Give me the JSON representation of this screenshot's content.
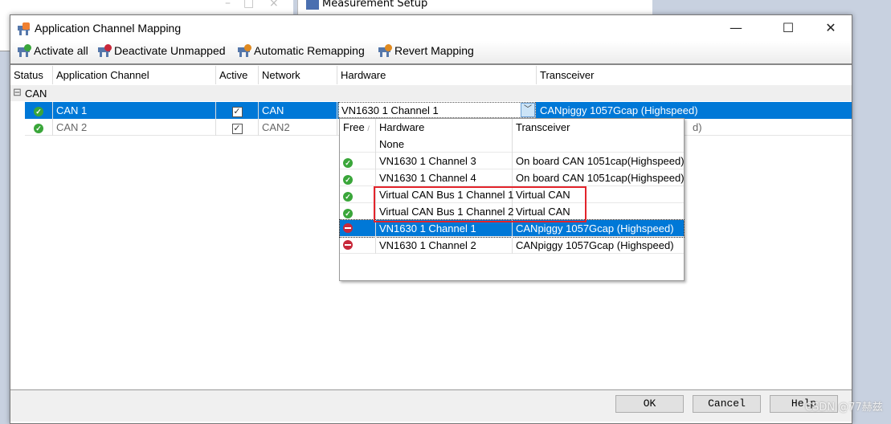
{
  "background": {
    "window_title": "Measurement Setup"
  },
  "dialog": {
    "title": "Application Channel Mapping",
    "toolbar": {
      "activate_all": "Activate all",
      "deactivate_unmapped": "Deactivate Unmapped",
      "automatic_remapping": "Automatic Remapping",
      "revert_mapping": "Revert Mapping"
    },
    "columns": [
      "Status",
      "Application Channel",
      "Active",
      "Network",
      "Hardware",
      "Transceiver"
    ],
    "group": {
      "label": "CAN",
      "expander": "⊟"
    },
    "rows": [
      {
        "status": "ok",
        "channel": "CAN 1",
        "active": true,
        "network": "CAN",
        "hardware": "VN1630 1 Channel 1",
        "transceiver": "CANpiggy 1057Gcap (Highspeed)",
        "selected": true
      },
      {
        "status": "ok",
        "channel": "CAN 2",
        "active": true,
        "network": "CAN2",
        "hardware": "",
        "transceiver": "d)",
        "selected": false
      }
    ],
    "dropdown": {
      "columns": [
        "Free",
        "Hardware",
        "Transceiver"
      ],
      "sort_indicator": "/",
      "items": [
        {
          "free": "",
          "hardware": "None",
          "transceiver": ""
        },
        {
          "free": "ok",
          "hardware": "VN1630 1 Channel 3",
          "transceiver": "On board CAN 1051cap(Highspeed)"
        },
        {
          "free": "ok",
          "hardware": "VN1630 1 Channel 4",
          "transceiver": "On board CAN 1051cap(Highspeed)"
        },
        {
          "free": "ok",
          "hardware": "Virtual CAN Bus 1 Channel 1",
          "transceiver": "Virtual CAN"
        },
        {
          "free": "ok",
          "hardware": "Virtual CAN Bus 1 Channel 2",
          "transceiver": "Virtual CAN"
        },
        {
          "free": "used",
          "hardware": "VN1630 1 Channel 1",
          "transceiver": "CANpiggy 1057Gcap (Highspeed)",
          "selected": true
        },
        {
          "free": "used",
          "hardware": "VN1630 1 Channel 2",
          "transceiver": "CANpiggy 1057Gcap (Highspeed)"
        }
      ]
    },
    "buttons": {
      "ok": "OK",
      "cancel": "Cancel",
      "help": "Help"
    },
    "highlight_color": "#e3242b",
    "accent": "#0078d7"
  },
  "watermark": "CSDN @77赫兹"
}
